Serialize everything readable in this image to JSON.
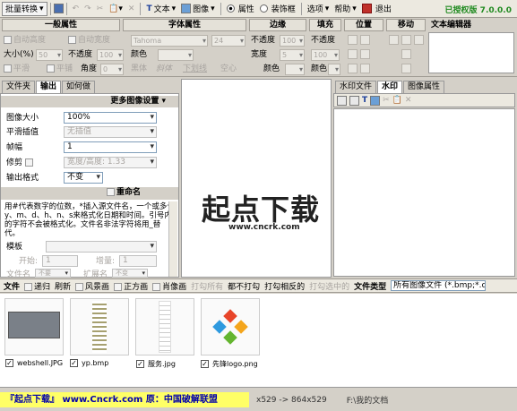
{
  "toolbar": {
    "batch": "批量转换",
    "text": "文本",
    "image": "图像",
    "props": "属性",
    "decor": "装饰框",
    "options": "选项",
    "help": "帮助",
    "exit": "退出",
    "version": "已授权版 7.0.0.0"
  },
  "props": {
    "general": "一般属性",
    "font": "字体属性",
    "edge": "边缘",
    "fill": "填充",
    "position": "位置",
    "move": "移动",
    "text_editor": "文本编辑器",
    "auto_h": "自动高度",
    "auto_w": "自动宽度",
    "font_name": "Tahoma",
    "font_size": "24",
    "opacity1": "不透度",
    "opacity2": "不透度",
    "opacity_val": "100",
    "size": "大小(%)",
    "size_val": "50",
    "opacity3": "不透度",
    "opacity3_val": "100",
    "color1": "颜色",
    "color2": "颜色",
    "color3": "颜色",
    "width": "宽度",
    "width_val": "5",
    "flat": "平滑",
    "smooth": "平铺",
    "angle": "角度",
    "angle_val": "0",
    "bold": "黑体",
    "italic": "斜体",
    "underline": "下划线",
    "hollow": "空心"
  },
  "left": {
    "tab1": "文件夹",
    "tab2": "输出",
    "tab3": "如何做",
    "more": "更多图像设置",
    "img_size": "图像大小",
    "img_size_val": "100%",
    "smooth_label": "平滑插值",
    "smooth_val": "无插值",
    "frame": "帧幅",
    "frame_val": "1",
    "crop": "修剪",
    "crop_val": "宽度/高度: 1.33",
    "format": "输出格式",
    "format_val": "不变",
    "rename": "重命名",
    "rename_desc": "用#代表数字的位数，*插入源文件名，一个或多个y、m、d、h、n、s来格式化日期和时间。引号内的字符不会被格式化。文件名非法字符将用_替代。",
    "template": "模板",
    "start": "开始:",
    "start_val": "1",
    "incr": "增量:",
    "incr_val": "1",
    "filename": "文件名",
    "filename_val": "不要",
    "ext": "扩展名",
    "ext_val": "不变"
  },
  "right": {
    "tab1": "水印文件",
    "tab2": "水印",
    "tab3": "图像属性"
  },
  "watermark": {
    "line1": "起点下载",
    "line2": "www.cncrk.com"
  },
  "filebar": {
    "files": "文件",
    "recurse": "递归",
    "refresh": "刷新",
    "landscape": "风景画",
    "square": "正方画",
    "portrait": "肖像画",
    "print_all": "打勾所有",
    "print_none": "都不打勾",
    "print_inverse": "打勾相反的",
    "print_sel": "打勾选中的",
    "file_type": "文件类型",
    "file_type_val": "所有图像文件 (*.bmp;*.c"
  },
  "files": [
    {
      "name": "webshell.JPG"
    },
    {
      "name": "yp.bmp"
    },
    {
      "name": "服务.jpg"
    },
    {
      "name": "先锋logo.png"
    }
  ],
  "status": {
    "banner": "『起点下载』 www.Cncrk.com 原：中国破解联盟",
    "dims": "x529  ->  864x529",
    "path": "F:\\我的文档"
  }
}
